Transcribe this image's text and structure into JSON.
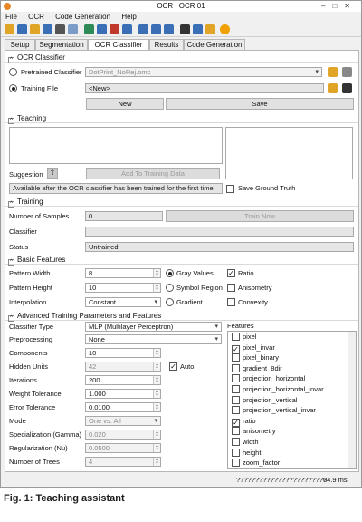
{
  "window": {
    "title": "OCR : OCR 01"
  },
  "menu": [
    "File",
    "OCR",
    "Code Generation",
    "Help"
  ],
  "colors": {
    "accent": "#e8872a",
    "folder_icon": "#e0a526",
    "help_icon": "#f0a000"
  },
  "tabs": [
    "Setup",
    "Segmentation",
    "OCR Classifier",
    "Results",
    "Code Generation"
  ],
  "ocr_classifier": {
    "header": "OCR Classifier",
    "pretrained_label": "Pretrained Classifier",
    "pretrained_value": "DotPrint_NoRej.omc",
    "training_label": "Training File",
    "training_value": "<New>",
    "new_button": "New",
    "save_button": "Save"
  },
  "teaching": {
    "header": "Teaching",
    "suggestion_label": "Suggestion",
    "add_button": "Add To Training Data",
    "info": "Available after the OCR classifier has been trained for the first time",
    "save_ground_truth": "Save Ground Truth"
  },
  "training": {
    "header": "Training",
    "samples_label": "Number of Samples",
    "samples_value": "0",
    "train_button": "Train Now",
    "classifier_label": "Classifier",
    "classifier_value": "",
    "status_label": "Status",
    "status_value": "Untrained"
  },
  "basic": {
    "header": "Basic Features",
    "width_label": "Pattern Width",
    "width_value": "8",
    "height_label": "Pattern Height",
    "height_value": "10",
    "interp_label": "Interpolation",
    "interp_value": "Constant",
    "radio_gray": "Gray Values",
    "radio_symbol": "Symbol Region",
    "radio_gradient": "Gradient",
    "chk_ratio": "Ratio",
    "chk_anisometry": "Anisometry",
    "chk_convexity": "Convexity"
  },
  "advanced": {
    "header": "Advanced Training Parameters and Features",
    "rows": [
      {
        "label": "Classifier Type",
        "value": "MLP (Multilayer Perceptron)"
      },
      {
        "label": "Preprocessing",
        "value": "None"
      },
      {
        "label": "Components",
        "value": "10"
      },
      {
        "label": "Hidden Units",
        "value": "42"
      },
      {
        "label": "Iterations",
        "value": "200"
      },
      {
        "label": "Weight Tolerance",
        "value": "1.000"
      },
      {
        "label": "Error Tolerance",
        "value": "0.0100"
      },
      {
        "label": "Mode",
        "value": "One vs. All"
      },
      {
        "label": "Specialization (Gamma)",
        "value": "0.020"
      },
      {
        "label": "Regularization (Nu)",
        "value": "0.0500"
      },
      {
        "label": "Number of Trees",
        "value": "4"
      }
    ],
    "auto_label": "Auto",
    "features_label": "Features",
    "features": [
      {
        "name": "pixel",
        "checked": false
      },
      {
        "name": "pixel_invar",
        "checked": true
      },
      {
        "name": "pixel_binary",
        "checked": false
      },
      {
        "name": "gradient_8dir",
        "checked": false
      },
      {
        "name": "projection_horizontal",
        "checked": false
      },
      {
        "name": "projection_horizontal_invar",
        "checked": false
      },
      {
        "name": "projection_vertical",
        "checked": false
      },
      {
        "name": "projection_vertical_invar",
        "checked": false
      },
      {
        "name": "ratio",
        "checked": true
      },
      {
        "name": "anisometry",
        "checked": false
      },
      {
        "name": "width",
        "checked": false
      },
      {
        "name": "height",
        "checked": false
      },
      {
        "name": "zoom_factor",
        "checked": false
      },
      {
        "name": "foreground",
        "checked": false
      }
    ]
  },
  "status": {
    "text": "????????????????????????",
    "time": "64.9 ms"
  },
  "caption": {
    "fig": "Fig. 1:",
    "title": "Teaching assistant"
  }
}
